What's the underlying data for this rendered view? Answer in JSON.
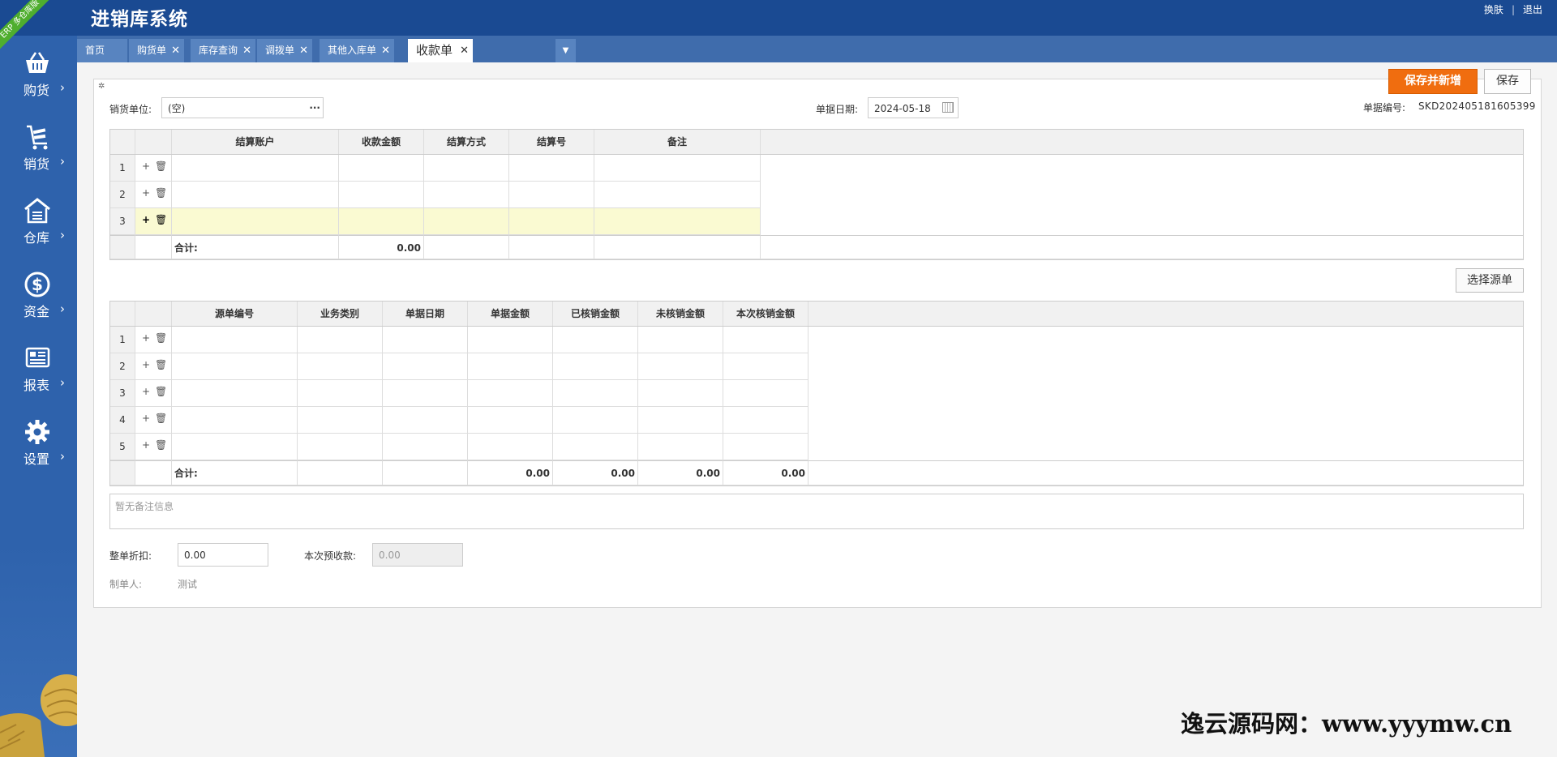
{
  "app": {
    "title": "进销库系统",
    "ribbon": "ERP 多仓库版"
  },
  "top_links": {
    "skin": "换肤",
    "logout": "退出"
  },
  "sidebar": [
    {
      "label": "购货",
      "icon": "basket-icon"
    },
    {
      "label": "销货",
      "icon": "cart-icon"
    },
    {
      "label": "仓库",
      "icon": "warehouse-icon"
    },
    {
      "label": "资金",
      "icon": "dollar-icon"
    },
    {
      "label": "报表",
      "icon": "report-icon"
    },
    {
      "label": "设置",
      "icon": "gear-icon"
    }
  ],
  "tabs": [
    {
      "label": "首页",
      "closable": false
    },
    {
      "label": "购货单",
      "closable": true
    },
    {
      "label": "库存查询",
      "closable": true
    },
    {
      "label": "调拨单",
      "closable": true
    },
    {
      "label": "其他入库单",
      "closable": true
    },
    {
      "label": "收款单",
      "closable": true,
      "active": true
    }
  ],
  "form": {
    "customer_label": "销货单位:",
    "customer_value": "(空)",
    "date_label": "单据日期:",
    "date_value": "2024-05-18",
    "docno_label": "单据编号:",
    "docno_value": "SKD202405181605399"
  },
  "buttons": {
    "save_new": "保存并新增",
    "save": "保存",
    "select_source": "选择源单"
  },
  "grid1": {
    "headers": [
      "结算账户",
      "收款金额",
      "结算方式",
      "结算号",
      "备注"
    ],
    "rows": [
      "1",
      "2",
      "3"
    ],
    "total_label": "合计:",
    "total_amount": "0.00"
  },
  "grid2": {
    "headers": [
      "源单编号",
      "业务类别",
      "单据日期",
      "单据金额",
      "已核销金额",
      "未核销金额",
      "本次核销金额"
    ],
    "rows": [
      "1",
      "2",
      "3",
      "4",
      "5"
    ],
    "total_label": "合计:",
    "totals": [
      "0.00",
      "0.00",
      "0.00",
      "0.00"
    ]
  },
  "memo_placeholder": "暂无备注信息",
  "footer": {
    "discount_label": "整单折扣:",
    "discount_value": "0.00",
    "prepay_label": "本次预收款:",
    "prepay_value": "0.00",
    "creator_label": "制单人:",
    "creator_value": "测试"
  },
  "watermark": "逸云源码网：www.yyymw.cn",
  "colors": {
    "topbar": "#1a4a92",
    "sidebar": "#2e62ac",
    "accent": "#f06d0f",
    "row_highlight": "#fafad2"
  }
}
